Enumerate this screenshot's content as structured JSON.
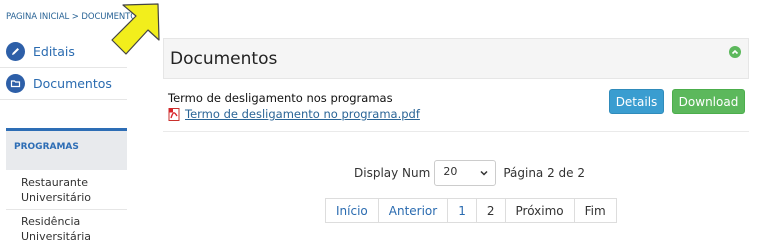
{
  "breadcrumb": "PAGINA INICIAL > DOCUMENTOS",
  "sidebar": {
    "links": [
      {
        "label": "Editais",
        "icon": "pencil-icon"
      },
      {
        "label": "Documentos",
        "icon": "folder-icon"
      }
    ],
    "programs_title": "PROGRAMAS",
    "programs": [
      {
        "line1": "Restaurante",
        "line2": "Universitário"
      },
      {
        "line1": "Residência",
        "line2": "Universitária"
      }
    ]
  },
  "panel": {
    "title": "Documentos",
    "collapse_icon": "chevron-up-icon"
  },
  "document": {
    "title": "Termo de desligamento nos programas",
    "file_name": "Termo de desligamento no programa.pdf",
    "details_label": "Details",
    "download_label": "Download"
  },
  "listing": {
    "display_label": "Display Num",
    "display_value": "20",
    "page_info": "Página 2 de 2"
  },
  "pagination": {
    "first": "Início",
    "prev": "Anterior",
    "pages": [
      "1",
      "2"
    ],
    "next": "Próximo",
    "last": "Fim"
  },
  "colors": {
    "link": "#2a6bb0",
    "accent_blue": "#2d6db5",
    "details_btn": "#3a9dd0",
    "download_btn": "#5cb85c",
    "pointer_arrow": "#f2ee1c"
  }
}
